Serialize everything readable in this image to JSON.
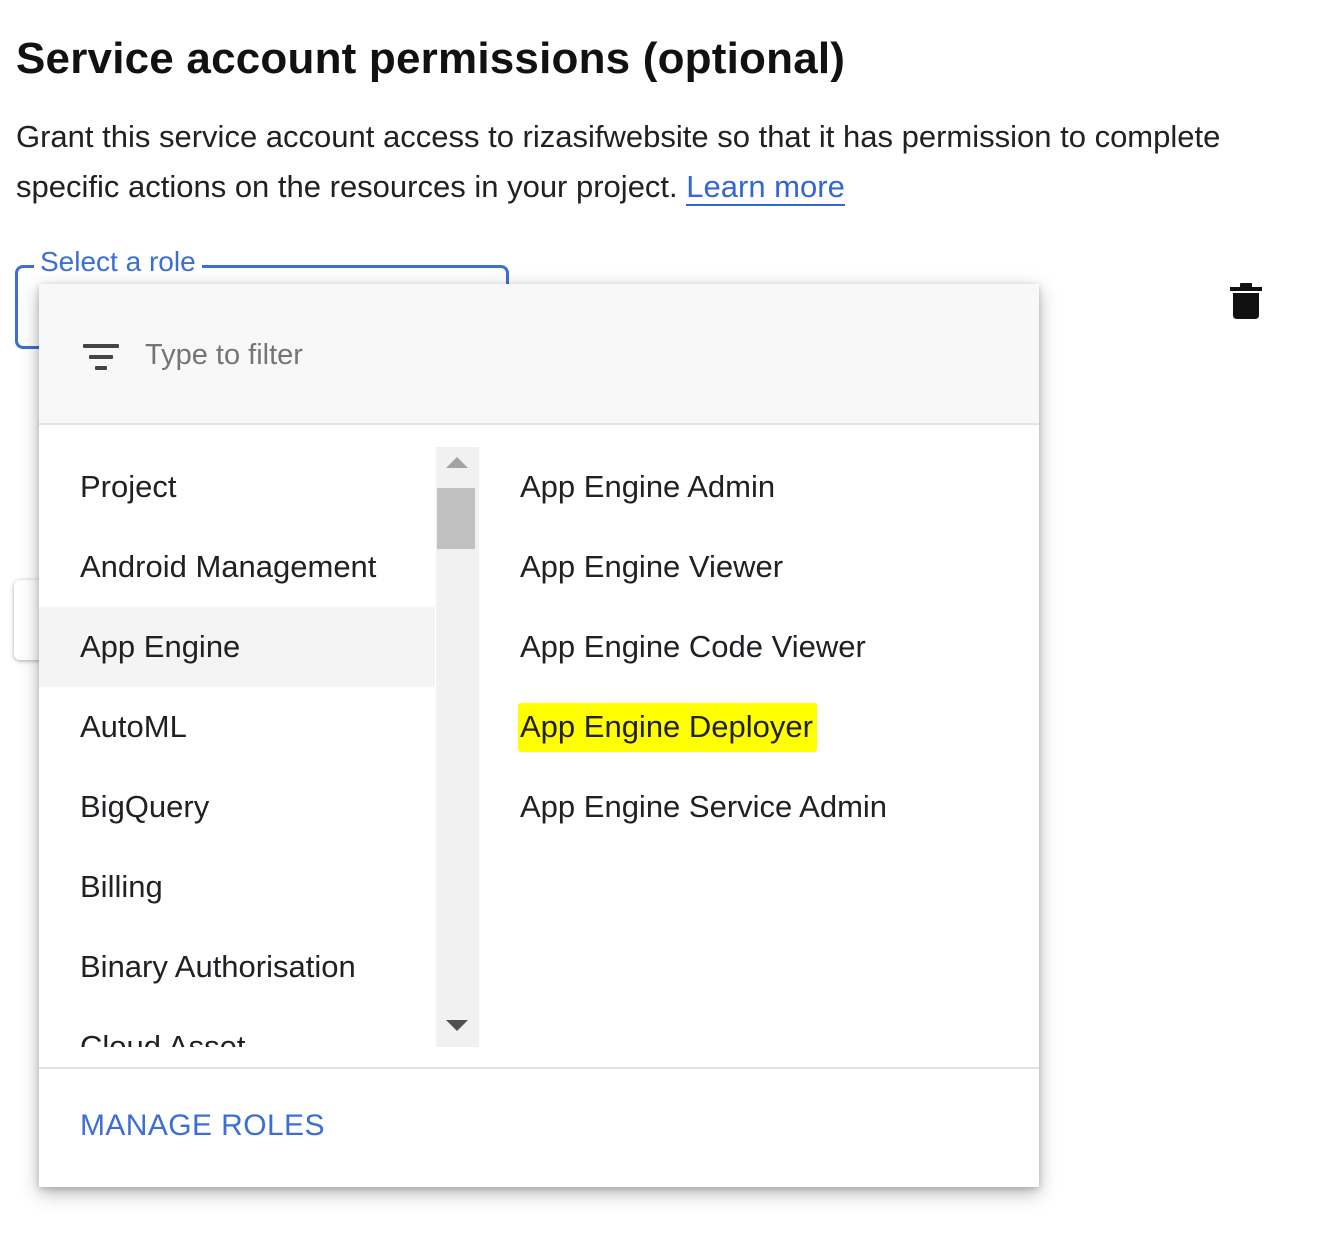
{
  "section": {
    "title": "Service account permissions (optional)",
    "description": "Grant this service account access to rizasifwebsite so that it has permission to complete specific actions on the resources in your project.",
    "learn_more": "Learn more"
  },
  "role_select": {
    "label": "Select a role"
  },
  "icons": {
    "delete": "trash-icon",
    "filter": "filter-list-icon"
  },
  "menu": {
    "filter_placeholder": "Type to filter",
    "categories": [
      "Project",
      "Android Management",
      "App Engine",
      "AutoML",
      "BigQuery",
      "Billing",
      "Binary Authorisation",
      "Cloud Asset"
    ],
    "selected_category": "App Engine",
    "roles": [
      "App Engine Admin",
      "App Engine Viewer",
      "App Engine Code Viewer",
      "App Engine Deployer",
      "App Engine Service Admin"
    ],
    "highlighted_role": "App Engine Deployer",
    "manage_roles": "MANAGE ROLES"
  },
  "colors": {
    "accent": "#3b6fd4",
    "highlight": "#ffff00"
  }
}
